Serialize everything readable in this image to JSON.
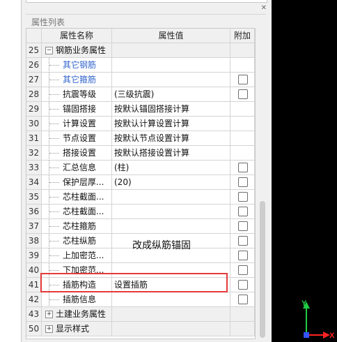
{
  "panel": {
    "title": "属性列表",
    "close_icon": "close-icon",
    "columns": {
      "num": "",
      "name": "属性名称",
      "value": "属性值",
      "add": "附加"
    }
  },
  "rows": [
    {
      "num": "25",
      "name": "钢筋业务属性",
      "value": "",
      "type": "group",
      "expanded": true,
      "checkbox": false
    },
    {
      "num": "26",
      "name": "其它钢筋",
      "value": "",
      "type": "link",
      "checkbox": false
    },
    {
      "num": "27",
      "name": "其它箍筋",
      "value": "",
      "type": "link",
      "checkbox": true
    },
    {
      "num": "28",
      "name": "抗震等级",
      "value": "(三级抗震)",
      "type": "item",
      "checkbox": true
    },
    {
      "num": "29",
      "name": "锚固搭接",
      "value": "按默认锚固搭接计算",
      "type": "item",
      "checkbox": false
    },
    {
      "num": "30",
      "name": "计算设置",
      "value": "按默认计算设置计算",
      "type": "item",
      "checkbox": false
    },
    {
      "num": "31",
      "name": "节点设置",
      "value": "按默认节点设置计算",
      "type": "item",
      "checkbox": false
    },
    {
      "num": "32",
      "name": "搭接设置",
      "value": "按默认搭接设置计算",
      "type": "item",
      "checkbox": false
    },
    {
      "num": "33",
      "name": "汇总信息",
      "value": "(柱)",
      "type": "item",
      "checkbox": true
    },
    {
      "num": "34",
      "name": "保护层厚...",
      "value": "(20)",
      "type": "item",
      "checkbox": true
    },
    {
      "num": "35",
      "name": "芯柱截面...",
      "value": "",
      "type": "item",
      "checkbox": true
    },
    {
      "num": "36",
      "name": "芯柱截面...",
      "value": "",
      "type": "item",
      "checkbox": true
    },
    {
      "num": "37",
      "name": "芯柱箍筋",
      "value": "",
      "type": "item",
      "checkbox": true
    },
    {
      "num": "38",
      "name": "芯柱纵筋",
      "value": "",
      "type": "item",
      "checkbox": true
    },
    {
      "num": "39",
      "name": "上加密范...",
      "value": "",
      "type": "item",
      "checkbox": true
    },
    {
      "num": "40",
      "name": "下加密范...",
      "value": "",
      "type": "item",
      "checkbox": true
    },
    {
      "num": "41",
      "name": "插筋构造",
      "value": "设置插筋",
      "type": "item",
      "checkbox": true
    },
    {
      "num": "42",
      "name": "插筋信息",
      "value": "",
      "type": "item",
      "checkbox": true
    },
    {
      "num": "43",
      "name": "土建业务属性",
      "value": "",
      "type": "group",
      "expanded": false,
      "checkbox": false
    },
    {
      "num": "50",
      "name": "显示样式",
      "value": "",
      "type": "group",
      "expanded": false,
      "checkbox": false
    }
  ],
  "annotation": "改成纵筋锚固",
  "axis": {
    "y_label": "Y",
    "x_label": "X",
    "y_color": "#22cc44",
    "x_color": "#ff2222",
    "origin_color": "#3355ff"
  }
}
